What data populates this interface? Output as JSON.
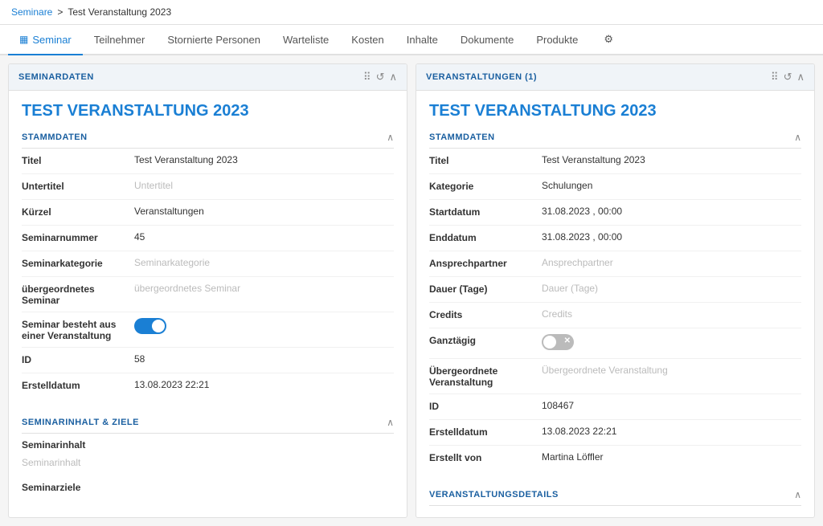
{
  "breadcrumb": {
    "link_label": "Seminare",
    "separator": ">",
    "current": "Test Veranstaltung 2023"
  },
  "tabs": [
    {
      "id": "seminar",
      "label": "Seminar",
      "icon": "grid",
      "active": true
    },
    {
      "id": "teilnehmer",
      "label": "Teilnehmer",
      "active": false
    },
    {
      "id": "stornierte",
      "label": "Stornierte Personen",
      "active": false
    },
    {
      "id": "warteliste",
      "label": "Warteliste",
      "active": false
    },
    {
      "id": "kosten",
      "label": "Kosten",
      "active": false
    },
    {
      "id": "inhalte",
      "label": "Inhalte",
      "active": false
    },
    {
      "id": "dokumente",
      "label": "Dokumente",
      "active": false
    },
    {
      "id": "produkte",
      "label": "Produkte",
      "active": false
    },
    {
      "id": "settings",
      "label": "",
      "icon": "gear",
      "active": false
    }
  ],
  "left_panel": {
    "header": "SEMINARDATEN",
    "main_title": "TEST VERANSTALTUNG 2023",
    "stammdaten": {
      "section_title": "STAMMDATEN",
      "fields": [
        {
          "label": "Titel",
          "value": "Test Veranstaltung 2023",
          "placeholder": false
        },
        {
          "label": "Untertitel",
          "value": "Untertitel",
          "placeholder": true
        },
        {
          "label": "Kürzel",
          "value": "Veranstaltungen",
          "placeholder": false
        },
        {
          "label": "Seminarnummer",
          "value": "45",
          "placeholder": false
        },
        {
          "label": "Seminarkategorie",
          "value": "Seminarkategorie",
          "placeholder": true
        },
        {
          "label": "übergeordnetes Seminar",
          "value": "übergeordnetes Seminar",
          "placeholder": true
        },
        {
          "label": "Seminar besteht aus einer Veranstaltung",
          "value": "",
          "toggle": true,
          "toggle_on": true
        },
        {
          "label": "ID",
          "value": "58",
          "placeholder": false
        },
        {
          "label": "Erstelldatum",
          "value": "13.08.2023 22:21",
          "placeholder": false
        }
      ]
    },
    "seminarinhalt": {
      "section_title": "SEMINARINHALT & ZIELE",
      "fields": [
        {
          "sublabel": "Seminarinhalt",
          "placeholder": "Seminarinhalt"
        },
        {
          "sublabel": "Seminarziele",
          "placeholder": ""
        }
      ]
    }
  },
  "right_panel": {
    "header": "VERANSTALTUNGEN (1)",
    "main_title": "TEST VERANSTALTUNG 2023",
    "stammdaten": {
      "section_title": "STAMMDATEN",
      "fields": [
        {
          "label": "Titel",
          "value": "Test Veranstaltung 2023",
          "placeholder": false
        },
        {
          "label": "Kategorie",
          "value": "Schulungen",
          "placeholder": false
        },
        {
          "label": "Startdatum",
          "value": "31.08.2023 , 00:00",
          "placeholder": false
        },
        {
          "label": "Enddatum",
          "value": "31.08.2023 , 00:00",
          "placeholder": false
        },
        {
          "label": "Ansprechpartner",
          "value": "Ansprechpartner",
          "placeholder": true
        },
        {
          "label": "Dauer (Tage)",
          "value": "Dauer (Tage)",
          "placeholder": true
        },
        {
          "label": "Credits",
          "value": "Credits",
          "placeholder": true
        },
        {
          "label": "Ganztägig",
          "value": "",
          "toggle": true,
          "toggle_on": false
        },
        {
          "label": "Übergeordnete Veranstaltung",
          "value": "Übergeordnete Veranstaltung",
          "placeholder": true
        },
        {
          "label": "ID",
          "value": "108467",
          "placeholder": false
        },
        {
          "label": "Erstelldatum",
          "value": "13.08.2023 22:21",
          "placeholder": false
        },
        {
          "label": "Erstellt von",
          "value": "Martina Löffler",
          "placeholder": false
        }
      ]
    },
    "veranstaltungsdetails": {
      "section_title": "VERANSTALTUNGSDETAILS"
    }
  },
  "icons": {
    "grid": "▦",
    "gear": "⚙",
    "dots": "⠿",
    "refresh": "↺",
    "chevron_up": "∧",
    "chevron_down": "∨"
  }
}
